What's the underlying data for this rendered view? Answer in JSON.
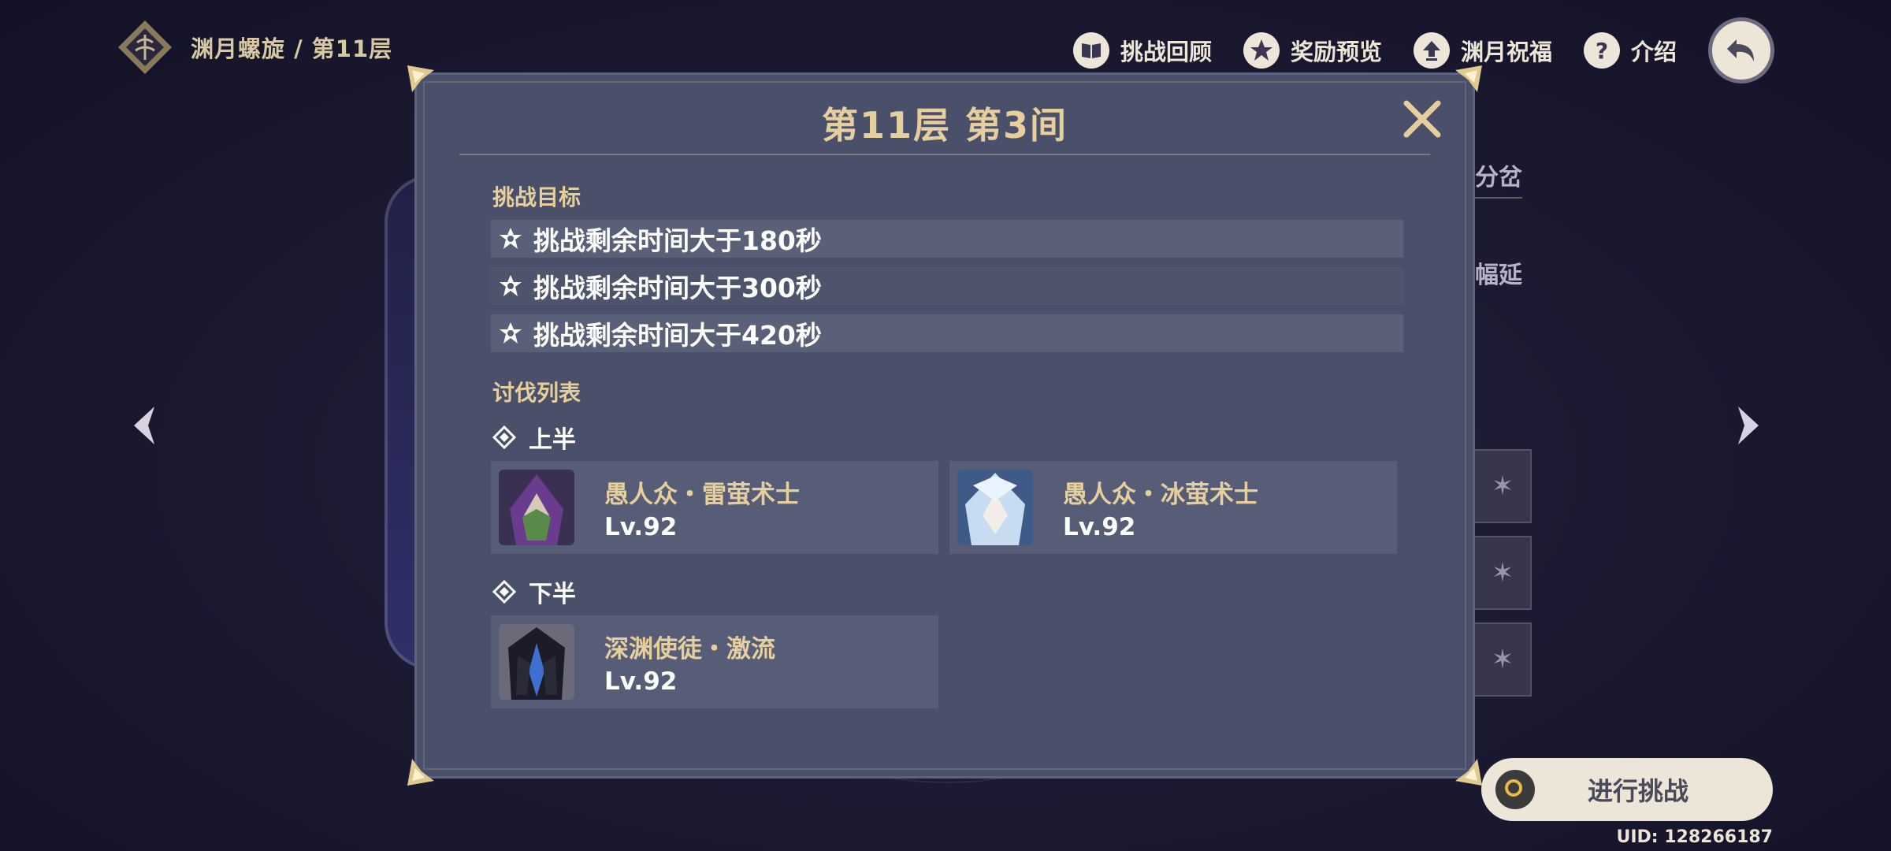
{
  "header": {
    "breadcrumb": "渊月螺旋 / 第11层",
    "nav": [
      {
        "label": "挑战回顾",
        "icon": "book-icon"
      },
      {
        "label": "奖励预览",
        "icon": "reward-star-icon"
      },
      {
        "label": "渊月祝福",
        "icon": "upload-arrow-icon"
      },
      {
        "label": "介绍",
        "icon": "question-icon"
      }
    ]
  },
  "background": {
    "right_text_1": "分岔",
    "right_text_2": "幅延"
  },
  "dialog": {
    "title": "第11层 第3间",
    "objectives_title": "挑战目标",
    "objectives": [
      "挑战剩余时间大于180秒",
      "挑战剩余时间大于300秒",
      "挑战剩余时间大于420秒"
    ],
    "enemy_list_title": "讨伐列表",
    "first_half": {
      "label": "上半",
      "enemies": [
        {
          "name": "愚人众・雷萤术士",
          "level": "Lv.92"
        },
        {
          "name": "愚人众・冰萤术士",
          "level": "Lv.92"
        }
      ]
    },
    "second_half": {
      "label": "下半",
      "enemies": [
        {
          "name": "深渊使徒・激流",
          "level": "Lv.92"
        }
      ]
    }
  },
  "challenge_button": "进行挑战",
  "uid": "UID: 128266187",
  "colors": {
    "accent_gold": "#e7cf9d",
    "dialog_bg": "#4a5069",
    "button_bg": "#ece5d8"
  }
}
